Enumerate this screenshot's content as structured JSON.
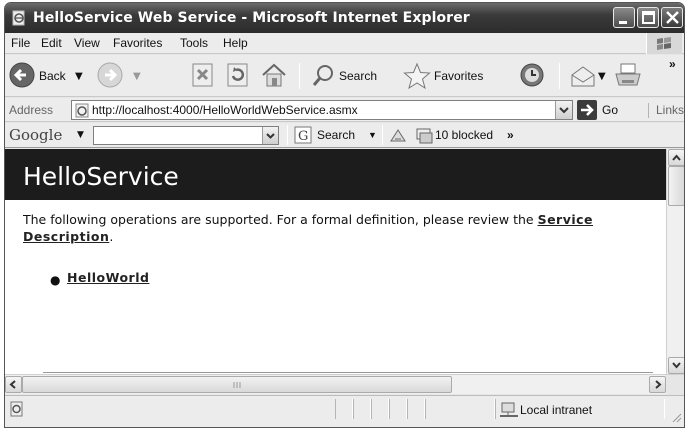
{
  "window": {
    "title": "HelloService Web Service - Microsoft Internet Explorer"
  },
  "menu": {
    "items": [
      "File",
      "Edit",
      "View",
      "Favorites",
      "Tools",
      "Help"
    ]
  },
  "toolbar": {
    "back_label": "Back",
    "search_label": "Search",
    "favorites_label": "Favorites",
    "more_label": "»"
  },
  "address": {
    "label": "Address",
    "url": "http://localhost:4000/HelloWorldWebService.asmx",
    "go_label": "Go",
    "links_label": "Links"
  },
  "google": {
    "logo": "Google",
    "search_label": "Search",
    "blocked_label": "10 blocked",
    "more_label": "»"
  },
  "page": {
    "heading": "HelloService",
    "description_prefix": "The following operations are supported. For a formal definition, please review the ",
    "service_description_link": "Service Description",
    "description_suffix": ".",
    "operations": [
      "HelloWorld"
    ]
  },
  "status": {
    "zone": "Local intranet"
  }
}
